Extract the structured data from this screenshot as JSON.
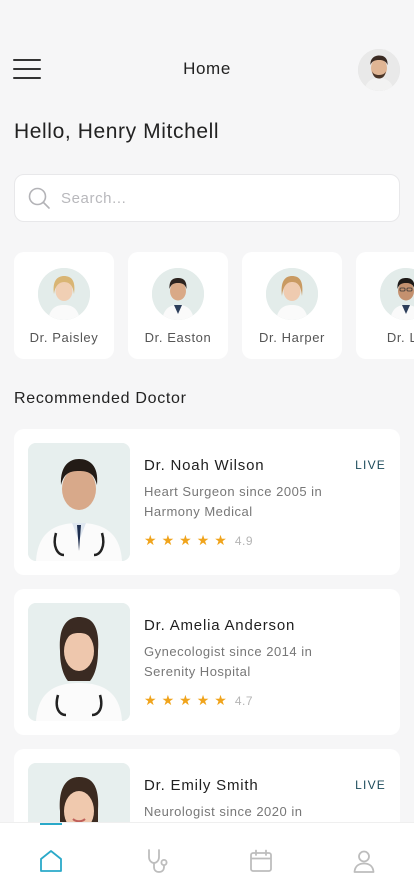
{
  "header": {
    "title": "Home"
  },
  "greeting": "Hello, Henry Mitchell",
  "search": {
    "placeholder": "Search..."
  },
  "top_doctors": [
    {
      "name": "Dr. Paisley"
    },
    {
      "name": "Dr. Easton"
    },
    {
      "name": "Dr. Harper"
    },
    {
      "name": "Dr. Lu"
    }
  ],
  "section_title": "Recommended Doctor",
  "recommended": [
    {
      "name": "Dr. Noah Wilson",
      "description": "Heart Surgeon since 2005 in Harmony Medical",
      "rating": "4.9",
      "live": "LIVE"
    },
    {
      "name": "Dr. Amelia Anderson",
      "description": "Gynecologist since 2014 in Serenity Hospital",
      "rating": "4.7",
      "live": ""
    },
    {
      "name": "Dr. Emily Smith",
      "description": "Neurologist since 2020 in",
      "rating": "",
      "live": "LIVE"
    }
  ],
  "tabs": [
    {
      "icon": "home-icon",
      "active": true
    },
    {
      "icon": "stethoscope-icon",
      "active": false
    },
    {
      "icon": "calendar-icon",
      "active": false
    },
    {
      "icon": "profile-icon",
      "active": false
    }
  ],
  "colors": {
    "accent": "#2aa9c9",
    "star": "#f0a41c",
    "live": "#1b4a5a"
  }
}
